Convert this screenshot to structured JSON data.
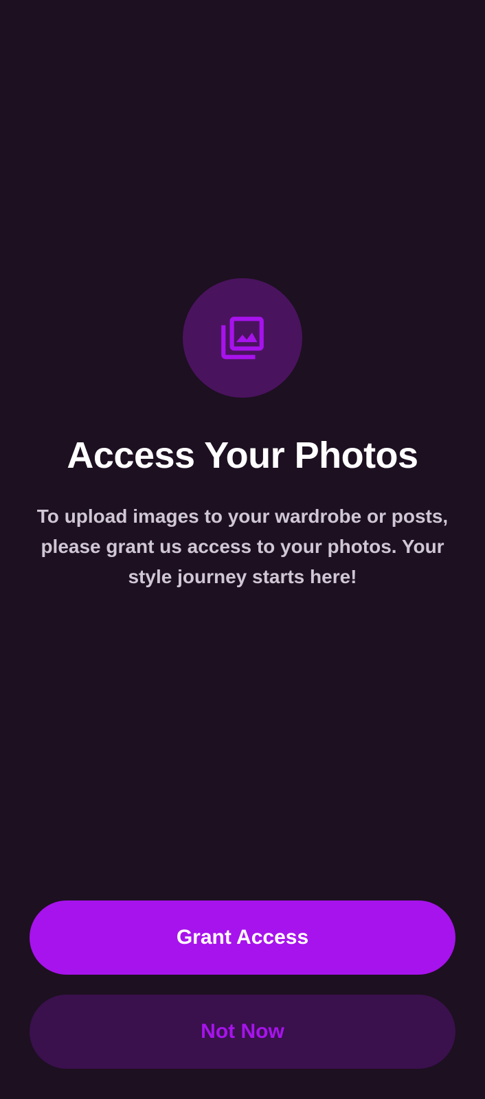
{
  "permission": {
    "icon": "photo-library-icon",
    "title": "Access Your Photos",
    "description": "To upload images to your wardrobe or posts, please grant us access to your photos. Your style journey starts here!"
  },
  "actions": {
    "grant_label": "Grant Access",
    "decline_label": "Not Now"
  },
  "colors": {
    "background": "#1d1021",
    "accent": "#a713ec",
    "icon_circle": "#4a135e",
    "secondary_button": "#3a104d",
    "description_text": "#cfc7d4"
  }
}
